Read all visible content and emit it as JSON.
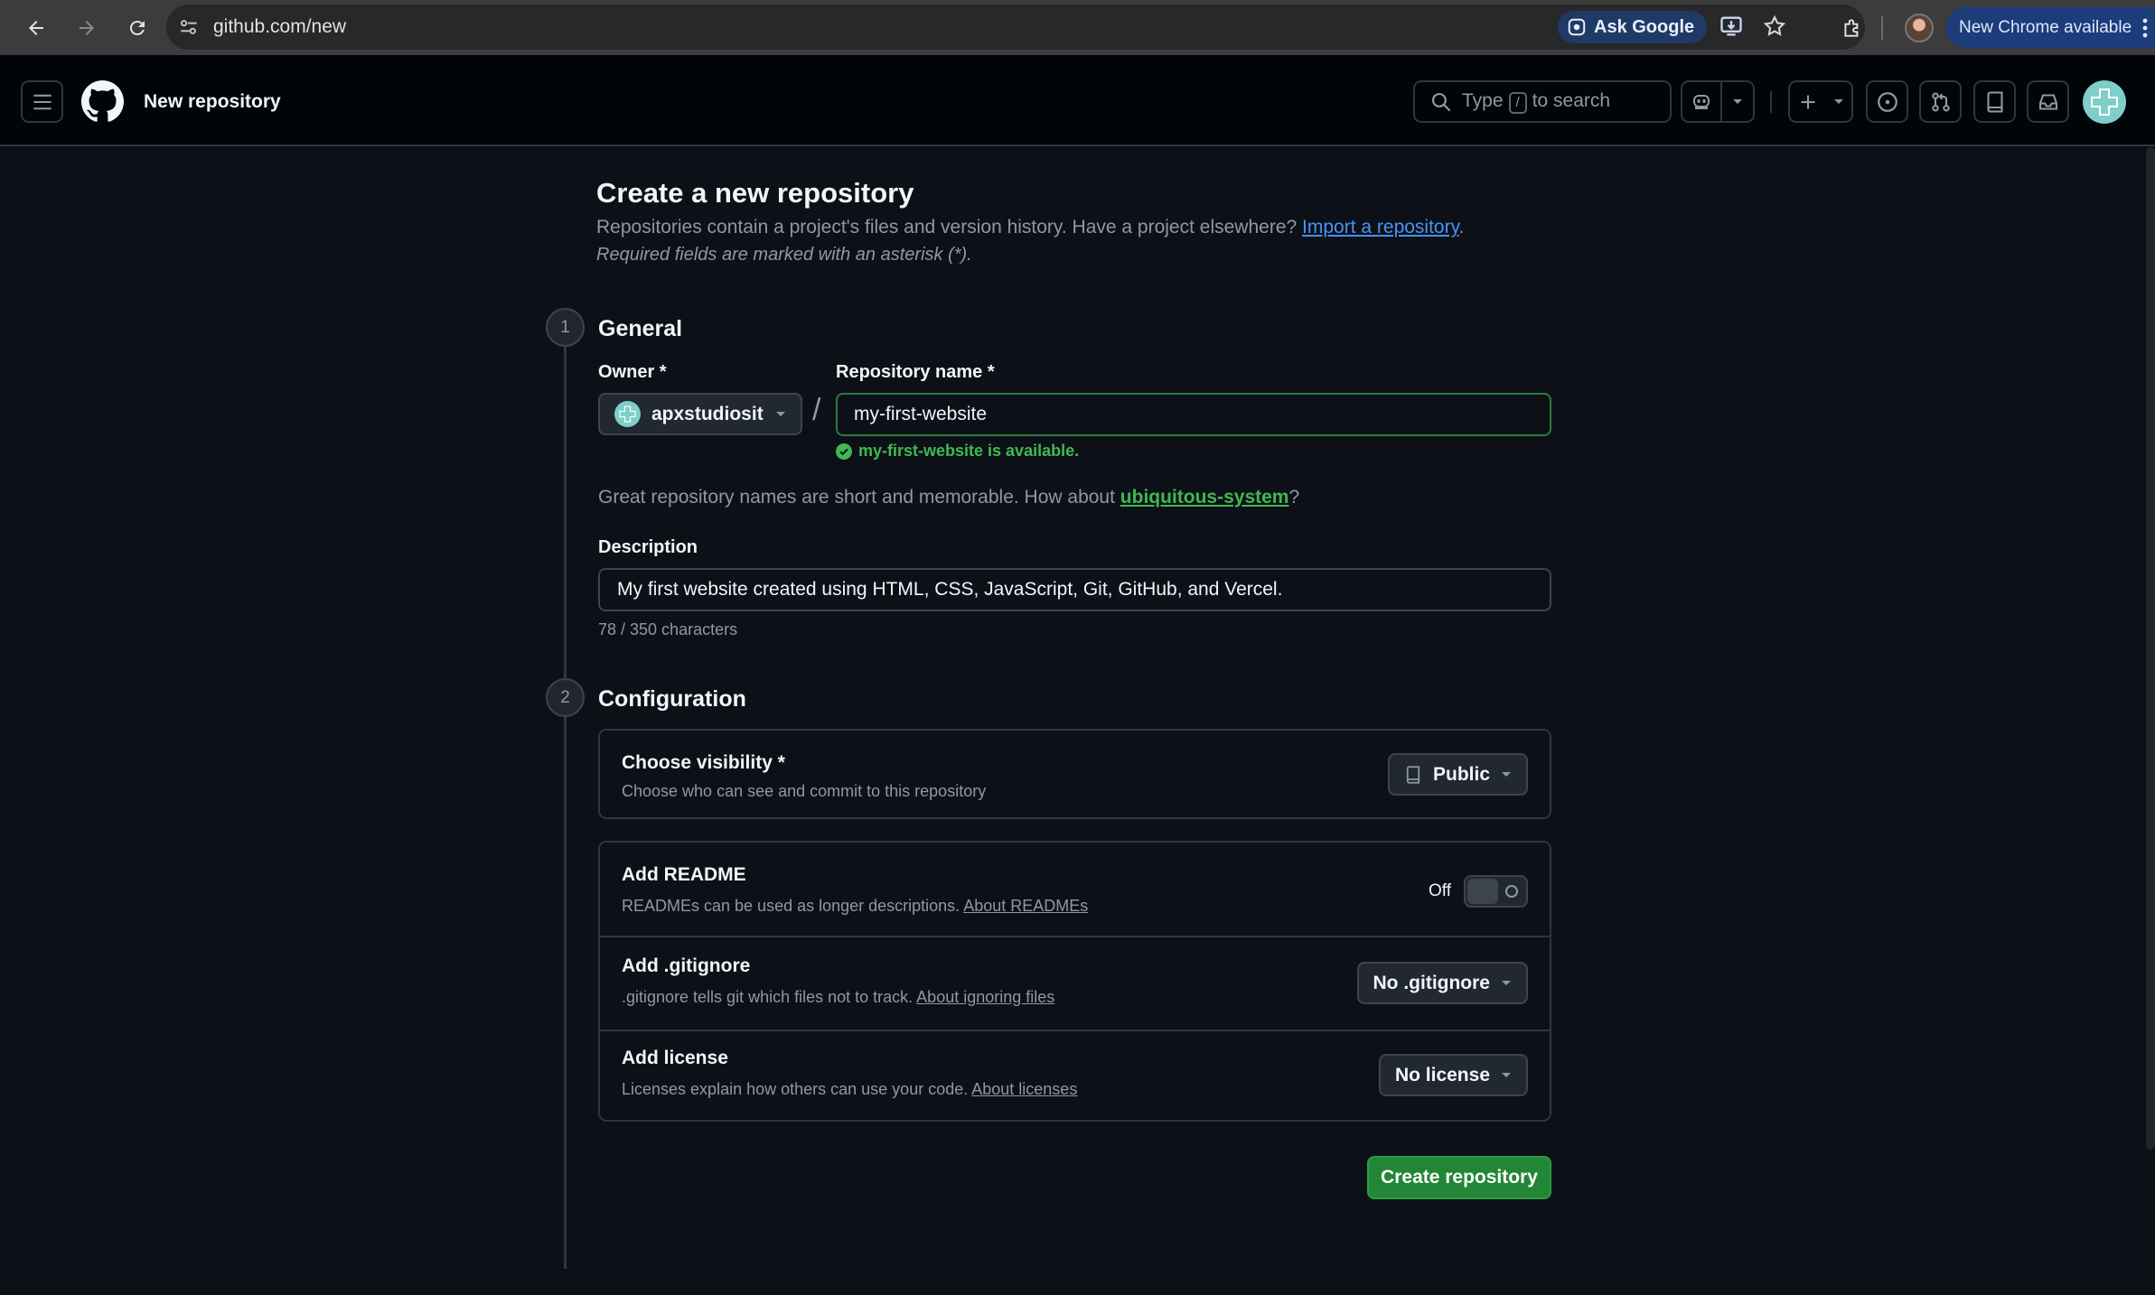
{
  "browser": {
    "url": "github.com/new",
    "ask_google": "Ask Google",
    "new_chrome": "New Chrome available"
  },
  "header": {
    "page_title": "New repository",
    "search_prefix": "Type",
    "search_key": "/",
    "search_suffix": "to search"
  },
  "page": {
    "title": "Create a new repository",
    "intro_text": "Repositories contain a project's files and version history. Have a project elsewhere?",
    "import_link": "Import a repository",
    "intro_end": ".",
    "required_note": "Required fields are marked with an asterisk (*)."
  },
  "general": {
    "step": "1",
    "heading": "General",
    "owner_label": "Owner *",
    "owner_value": "apxstudiosit",
    "repo_label": "Repository name *",
    "repo_value": "my-first-website",
    "available_msg": "my-first-website is available.",
    "suggest_text": "Great repository names are short and memorable. How about",
    "suggest_link": "ubiquitous-system",
    "suggest_end": "?",
    "description_label": "Description",
    "description_value": "My first website created using HTML, CSS, JavaScript, Git, GitHub, and Vercel.",
    "char_count": "78 / 350 characters"
  },
  "configuration": {
    "step": "2",
    "heading": "Configuration",
    "visibility": {
      "title": "Choose visibility *",
      "desc": "Choose who can see and commit to this repository",
      "value": "Public"
    },
    "readme": {
      "title": "Add README",
      "desc": "READMEs can be used as longer descriptions.",
      "link": "About READMEs",
      "toggle_label": "Off"
    },
    "gitignore": {
      "title": "Add .gitignore",
      "desc": ".gitignore tells git which files not to track.",
      "link": "About ignoring files",
      "value": "No .gitignore"
    },
    "license": {
      "title": "Add license",
      "desc": "Licenses explain how others can use your code.",
      "link": "About licenses",
      "value": "No license"
    }
  },
  "actions": {
    "create": "Create repository"
  },
  "colors": {
    "accent_green": "#238636",
    "success_text": "#3fb950",
    "link_blue": "#4493f8",
    "background": "#0d1117"
  }
}
